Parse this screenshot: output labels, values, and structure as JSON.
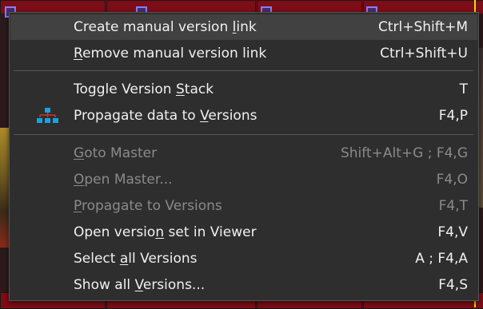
{
  "menu": {
    "items": [
      {
        "pre": "Create manual version ",
        "u": "l",
        "post": "ink",
        "shortcut": "Ctrl+Shift+M",
        "enabled": true,
        "hover": true,
        "icon": null
      },
      {
        "pre": "",
        "u": "R",
        "post": "emove manual version link",
        "shortcut": "Ctrl+Shift+U",
        "enabled": true,
        "hover": false,
        "icon": null
      },
      {
        "pre": "Toggle Version ",
        "u": "S",
        "post": "tack",
        "shortcut": "T",
        "enabled": true,
        "hover": false,
        "icon": null
      },
      {
        "pre": "Propagate data to ",
        "u": "V",
        "post": "ersions",
        "shortcut": "F4,P",
        "enabled": true,
        "hover": false,
        "icon": "hierarchy-icon"
      },
      {
        "pre": "",
        "u": "G",
        "post": "oto Master",
        "shortcut": "Shift+Alt+G ; F4,G",
        "enabled": false,
        "hover": false,
        "icon": null
      },
      {
        "pre": "",
        "u": "O",
        "post": "pen Master...",
        "shortcut": "F4,O",
        "enabled": false,
        "hover": false,
        "icon": null
      },
      {
        "pre": "",
        "u": "P",
        "post": "ropagate to Versions",
        "shortcut": "F4,T",
        "enabled": false,
        "hover": false,
        "icon": null
      },
      {
        "pre": "Open versio",
        "u": "n",
        "post": " set in Viewer",
        "shortcut": "F4,V",
        "enabled": true,
        "hover": false,
        "icon": null
      },
      {
        "pre": "Select ",
        "u": "a",
        "post": "ll Versions",
        "shortcut": "A ; F4,A",
        "enabled": true,
        "hover": false,
        "icon": null
      },
      {
        "pre": "Show all ",
        "u": "V",
        "post": "ersions...",
        "shortcut": "F4,S",
        "enabled": true,
        "hover": false,
        "icon": null
      }
    ]
  },
  "colors": {
    "menu_bg": "#2e2e2e",
    "hover_bg": "#414141",
    "text": "#f0f0f0",
    "disabled_text": "#8a8a8a",
    "icon_color": "#1aa3d8"
  }
}
